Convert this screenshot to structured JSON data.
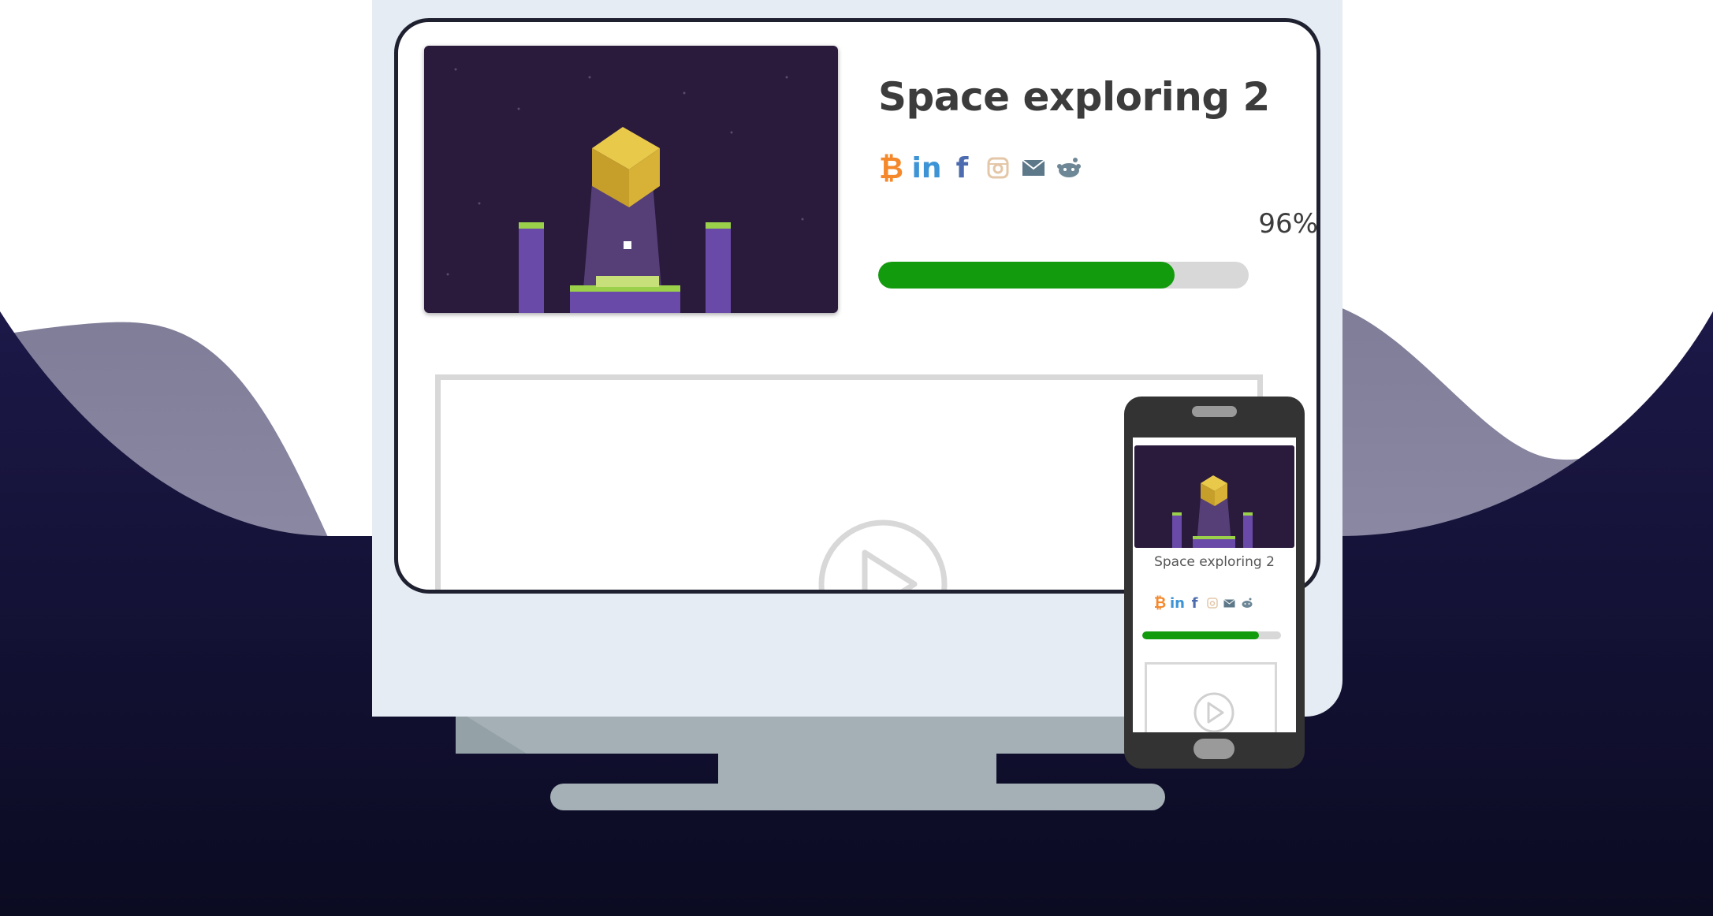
{
  "game": {
    "title": "Space exploring 2",
    "progress_label": "96%",
    "progress_value": 0.8
  },
  "share_icons": [
    {
      "name": "bitcoin-icon",
      "glyph": "₿",
      "color": "#f4882b"
    },
    {
      "name": "linkedin-icon",
      "glyph": "in",
      "color": "#3c94d6"
    },
    {
      "name": "facebook-icon",
      "glyph": "f",
      "color": "#4d6cb0"
    },
    {
      "name": "instagram-icon",
      "glyph": "◙",
      "color": "#e4c7a8"
    },
    {
      "name": "email-icon",
      "glyph": "✉",
      "color": "#5d7889"
    },
    {
      "name": "reddit-icon",
      "glyph": "●",
      "color": "#6d8796"
    }
  ],
  "phone": {
    "title": "Space exploring 2",
    "progress_value": 0.84
  },
  "colors": {
    "background_dark": "#0e0e2a",
    "wave_grey": "#7f7d98",
    "monitor_body": "#e5ecf3",
    "stand": "#a4b0b5",
    "progress_green": "#139b0e",
    "progress_track": "#d8d8d8",
    "title_text": "#3c3c3c",
    "game_bg": "#2a1a3c"
  }
}
